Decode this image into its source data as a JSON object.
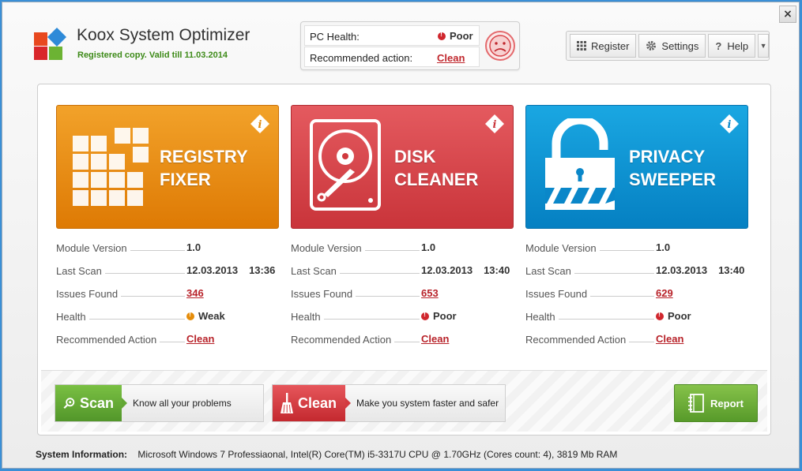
{
  "app": {
    "title": "Koox System Optimizer",
    "subtitle": "Registered copy. Valid till 11.03.2014"
  },
  "window": {
    "close_label": "×"
  },
  "health": {
    "pc_health_label": "PC Health:",
    "pc_health_value": "Poor",
    "recommended_label": "Recommended action:",
    "recommended_value": "Clean",
    "face_icon": "sad-face-icon"
  },
  "toolbar": {
    "register_label": "Register",
    "settings_label": "Settings",
    "help_label": "Help",
    "dropdown_label": "▼"
  },
  "labels": {
    "module_version": "Module Version",
    "last_scan": "Last Scan",
    "issues_found": "Issues Found",
    "health": "Health",
    "recommended_action": "Recommended Action"
  },
  "modules": [
    {
      "title_line1": "REGISTRY",
      "title_line2": "FIXER",
      "color": "#e8900f",
      "icon": "registry-blocks-icon",
      "version": "1.0",
      "last_scan_date": "12.03.2013",
      "last_scan_time": "13:36",
      "issues": "346",
      "health": "Weak",
      "health_color": "#e58c0a",
      "action": "Clean"
    },
    {
      "title_line1": "DISK",
      "title_line2": "CLEANER",
      "color": "#d9464b",
      "icon": "hard-disk-icon",
      "version": "1.0",
      "last_scan_date": "12.03.2013",
      "last_scan_time": "13:40",
      "issues": "653",
      "health": "Poor",
      "health_color": "#d0262d",
      "action": "Clean"
    },
    {
      "title_line1": "PRIVACY",
      "title_line2": "SWEEPER",
      "color": "#0d95d6",
      "icon": "padlock-icon",
      "version": "1.0",
      "last_scan_date": "12.03.2013",
      "last_scan_time": "13:40",
      "issues": "629",
      "health": "Poor",
      "health_color": "#d0262d",
      "action": "Clean"
    }
  ],
  "actions": {
    "scan_label": "Scan",
    "scan_desc": "Know all your problems",
    "clean_label": "Clean",
    "clean_desc": "Make you system faster and safer",
    "report_label": "Report"
  },
  "system": {
    "label": "System Information:",
    "value": "Microsoft Windows 7 Professiaonal, Intel(R) Core(TM) i5-3317U CPU @ 1.70GHz (Cores count: 4), 3819 Mb RAM"
  }
}
